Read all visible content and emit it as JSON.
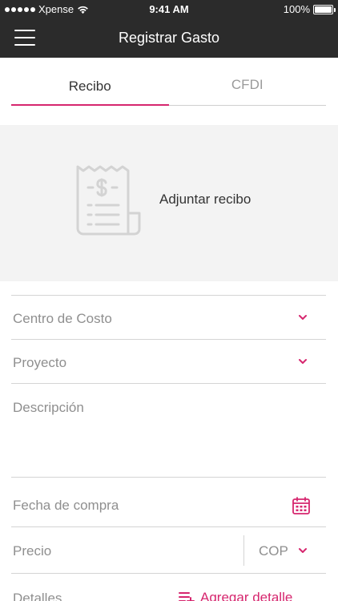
{
  "status_bar": {
    "carrier": "Xpense",
    "time": "9:41 AM",
    "battery": "100%",
    "battery_level": 1.0
  },
  "app_bar": {
    "title": "Registrar Gasto",
    "menu_icon": "hamburger-menu-icon"
  },
  "tabs": [
    {
      "label": "Recibo",
      "active": true
    },
    {
      "label": "CFDI",
      "active": false
    }
  ],
  "receipt": {
    "label": "Adjuntar recibo",
    "icon": "receipt-icon"
  },
  "form": {
    "cost_center": {
      "label": "Centro de Costo",
      "icon": "chevron-down-icon"
    },
    "project": {
      "label": "Proyecto",
      "icon": "chevron-down-icon"
    },
    "description": {
      "placeholder": "Descripción"
    },
    "purchase_date": {
      "label": "Fecha de compra",
      "icon": "calendar-icon"
    },
    "price": {
      "label": "Precio",
      "currency": "COP",
      "icon": "chevron-down-icon"
    },
    "details": {
      "label": "Detalles",
      "add_label": "Agregar detalle",
      "add_icon": "add-list-icon"
    }
  },
  "colors": {
    "header_bg": "#2b2b2b",
    "accent": "#d6266e",
    "receipt_bg": "#f3f3f3",
    "label_gray": "#8f8f8f"
  }
}
